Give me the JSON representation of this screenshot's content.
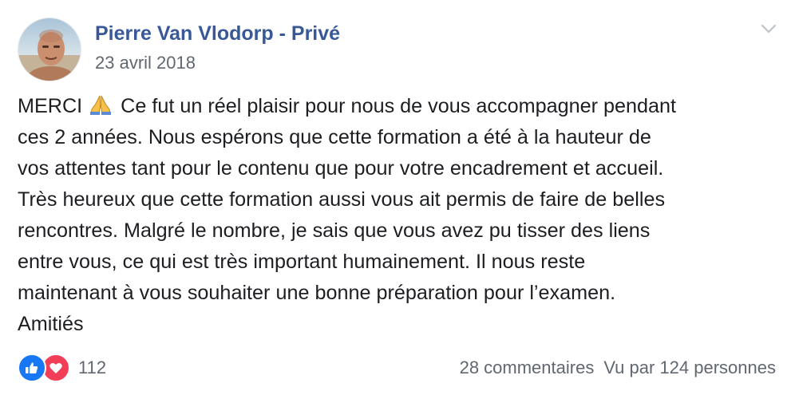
{
  "post": {
    "author": "Pierre Van Vlodorp - Privé",
    "date": "23 avril 2018",
    "body_lines": [
      {
        "pre": "MERCI",
        "post": "Ce fut un réel plaisir pour nous de vous accompagner pendant"
      },
      "ces 2 années. Nous espérons que cette formation a été à la hauteur de",
      "vos attentes tant pour le contenu que pour votre encadrement et accueil.",
      "Très heureux que cette formation aussi vous ait permis de faire de belles",
      "rencontres. Malgré le nombre, je sais que vous avez pu tisser des liens",
      "entre vous, ce qui est très important humainement. Il nous reste",
      "maintenant à vous souhaiter une bonne préparation pour l’examen.",
      "Amitiés"
    ],
    "emoji": "folded-hands-emoji"
  },
  "footer": {
    "reaction_icons": [
      "like-icon",
      "love-icon"
    ],
    "reaction_count": "112",
    "comments": "28 commentaires",
    "views": "Vu par 124 personnes"
  },
  "colors": {
    "author": "#385898",
    "meta": "#616770",
    "text": "#1c1e21",
    "like": "#1877f2",
    "love": "#f33e58"
  }
}
